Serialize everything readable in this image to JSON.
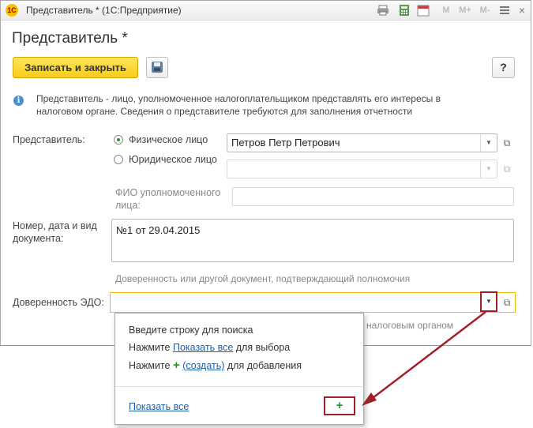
{
  "window": {
    "logo_text": "1С",
    "title": "Представитель * (1С:Предприятие)",
    "toolbar": {
      "m_label": "M",
      "m_plus_label": "M+",
      "m_minus_label": "M-",
      "calendar_day": "31",
      "close_glyph": "×"
    }
  },
  "form": {
    "title": "Представитель *",
    "save_close_label": "Записать и закрыть",
    "help_label": "?",
    "info_glyph": "i",
    "info_text": "Представитель - лицо, уполномоченное налогоплательщиком представлять его интересы в налоговом органе. Сведения о представителе требуются для заполнения отчетности",
    "representative_label": "Представитель:",
    "radio_individual": "Физическое лицо",
    "radio_legal": "Юридическое лицо",
    "individual_value": "Петров Петр Петрович",
    "legal_value": "",
    "authorized_person_label": "ФИО уполномоченного лица:",
    "authorized_person_value": "",
    "document_label": "Номер, дата и вид документа:",
    "document_value": "№1 от 29.04.2015",
    "document_hint": "Доверенность или другой документ, подтверждающий полномочия",
    "edo_label": "Доверенность ЭДО:",
    "edo_value": "",
    "edo_hint_behind": "налоговым органом"
  },
  "popup": {
    "line1": "Введите строку для поиска",
    "line2_prefix": "Нажмите",
    "line2_link": "Показать все",
    "line2_suffix": "для выбора",
    "line3_prefix": "Нажмите",
    "line3_link": "(создать)",
    "line3_suffix": "для добавления",
    "show_all_link": "Показать все",
    "plus_glyph": "+"
  },
  "colors": {
    "accent_yellow": "#f7cd1c",
    "highlight_red": "#a0202a",
    "link_blue": "#1f5fa8",
    "plus_green": "#1a9a2e"
  }
}
